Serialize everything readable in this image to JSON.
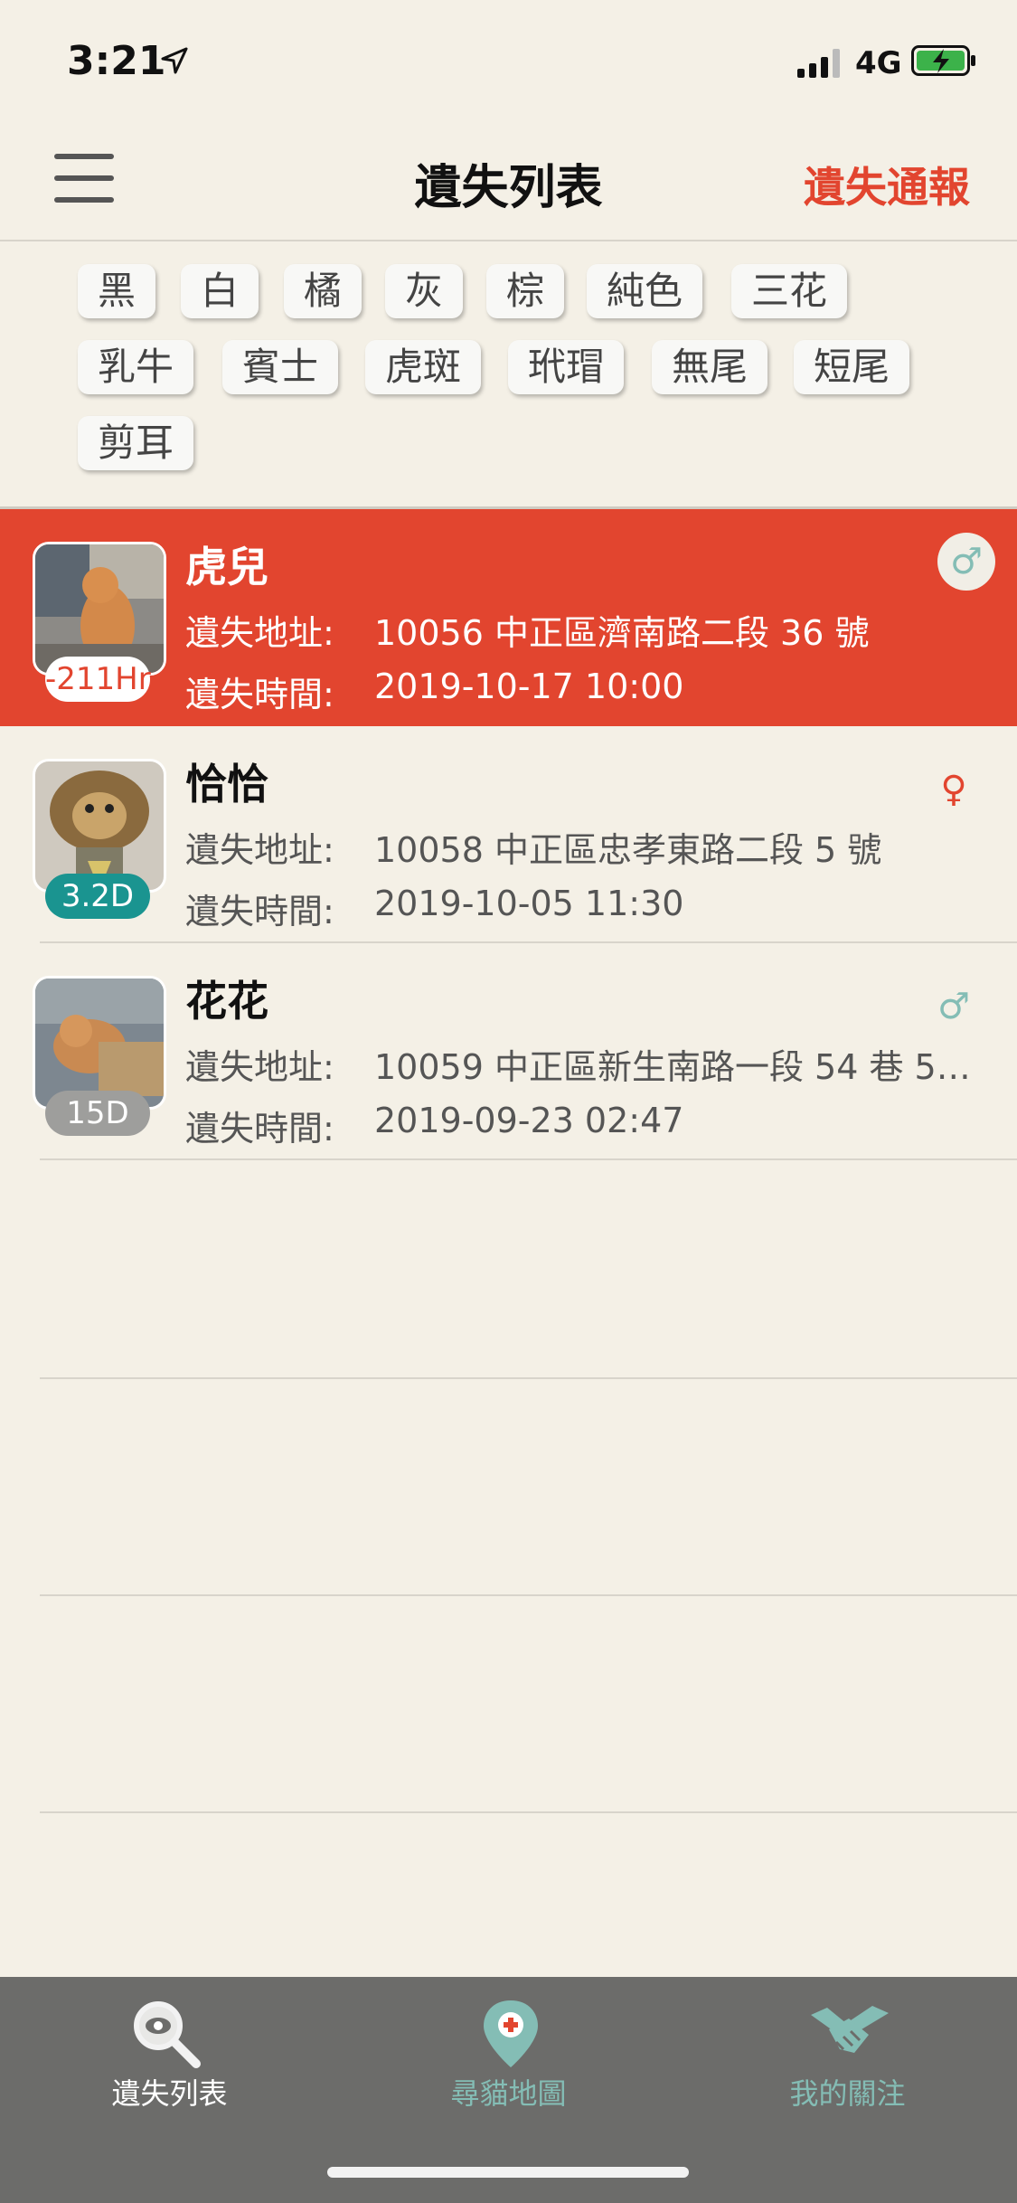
{
  "status_bar": {
    "time": "3:21",
    "network": "4G"
  },
  "nav": {
    "title": "遺失列表",
    "action": "遺失通報"
  },
  "filters": [
    "黑",
    "白",
    "橘",
    "灰",
    "棕",
    "純色",
    "三花",
    "乳牛",
    "賓士",
    "虎斑",
    "玳瑁",
    "無尾",
    "短尾",
    "剪耳"
  ],
  "labels": {
    "address": "遺失地址:",
    "time": "遺失時間:"
  },
  "pets": [
    {
      "name": "虎兒",
      "address": "10056 中正區濟南路二段 36 號",
      "time": "2019-10-17 10:00",
      "badge": "-211Hr",
      "gender": "♂",
      "selected": true
    },
    {
      "name": "恰恰",
      "address": "10058 中正區忠孝東路二段 5 號",
      "time": "2019-10-05 11:30",
      "badge": "3.2D",
      "gender": "♀",
      "selected": false
    },
    {
      "name": "花花",
      "address": "10059 中正區新生南路一段 54 巷 5…",
      "time": "2019-09-23 02:47",
      "badge": "15D",
      "gender": "♂",
      "selected": false
    }
  ],
  "tabs": [
    {
      "label": "遺失列表",
      "icon": "magnifier-eye-icon",
      "active": true
    },
    {
      "label": "尋貓地圖",
      "icon": "map-pin-icon",
      "active": false
    },
    {
      "label": "我的關注",
      "icon": "handshake-icon",
      "active": false
    }
  ],
  "colors": {
    "accent": "#e2452f",
    "teal": "#1a9490",
    "muted_teal": "#84bdb5",
    "background": "#f4f0e6",
    "tabbar": "#6c6c6a"
  }
}
